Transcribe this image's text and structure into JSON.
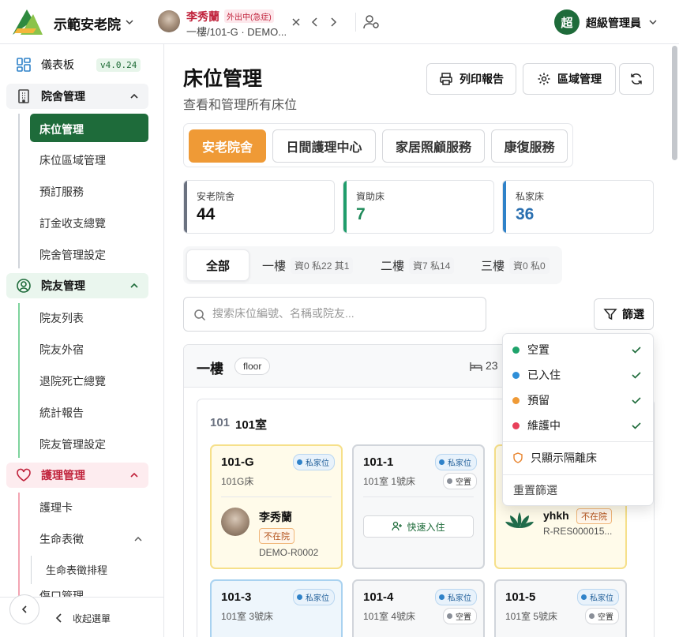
{
  "header": {
    "org_name": "示範安老院",
    "resident_name": "李秀蘭",
    "resident_badge": "外出中(急症)",
    "resident_location": "一樓/101-G · DEMO...",
    "admin_initial": "超",
    "admin_name": "超級管理員"
  },
  "sidebar": {
    "dashboard": "儀表板",
    "version": "v4.0.24",
    "groups": [
      {
        "label": "院舍管理",
        "items": [
          "床位管理",
          "床位區域管理",
          "預訂服務",
          "訂金收支總覽",
          "院舍管理設定"
        ]
      },
      {
        "label": "院友管理",
        "items": [
          "院友列表",
          "院友外宿",
          "退院死亡總覽",
          "統計報告",
          "院友管理設定"
        ]
      },
      {
        "label": "護理管理",
        "items": [
          "護理卡",
          "生命表徵",
          "生命表徵排程",
          "傷口管理"
        ]
      }
    ],
    "collapse_label": "收起選單"
  },
  "page": {
    "title": "床位管理",
    "subtitle": "查看和管理所有床位",
    "print_label": "列印報告",
    "zone_label": "區域管理",
    "service_tabs": [
      "安老院舍",
      "日間護理中心",
      "家居照顧服務",
      "康復服務"
    ],
    "stats": [
      {
        "label": "安老院舍",
        "value": "44",
        "color": "#6b7280"
      },
      {
        "label": "資助床",
        "value": "7",
        "color": "#1f9d6b"
      },
      {
        "label": "私家床",
        "value": "36",
        "color": "#2f82c9"
      }
    ],
    "floor_tabs": [
      {
        "label": "全部",
        "count": ""
      },
      {
        "label": "一樓",
        "count": "資0 私22 其1"
      },
      {
        "label": "二樓",
        "count": "資7 私14"
      },
      {
        "label": "三樓",
        "count": "資0 私0"
      }
    ],
    "search_placeholder": "搜索床位編號、名稱或院友...",
    "filter_label": "篩選"
  },
  "floor": {
    "name": "一樓",
    "tag": "floor",
    "bed_count": "23",
    "room_no": "101",
    "room_name": "101室"
  },
  "beds": [
    {
      "id": "101-G",
      "sub": "101G床",
      "type": "私家位",
      "resident": "李秀蘭",
      "status": "不在院",
      "code": "DEMO-R0002"
    },
    {
      "id": "101-1",
      "sub": "101室 1號床",
      "type": "私家位",
      "state": "空置",
      "action": "快速入住"
    },
    {
      "resident": "yhkh",
      "status": "不在院",
      "code": "R-RES000015..."
    },
    {
      "id": "101-3",
      "sub": "101室 3號床",
      "type": "私家位"
    },
    {
      "id": "101-4",
      "sub": "101室 4號床",
      "type": "私家位",
      "state": "空置"
    },
    {
      "id": "101-5",
      "sub": "101室 5號床",
      "type": "私家位",
      "state": "空置"
    }
  ],
  "filter_menu": {
    "statuses": [
      {
        "label": "空置",
        "color": "#1fa36b"
      },
      {
        "label": "已入住",
        "color": "#2f8fd8"
      },
      {
        "label": "預留",
        "color": "#ef9a36"
      },
      {
        "label": "維護中",
        "color": "#e8405a"
      }
    ],
    "quarantine_label": "只顯示隔離床",
    "reset_label": "重置篩選"
  },
  "colors": {
    "brand": "#1e6b3a",
    "accent": "#ef9a36"
  }
}
